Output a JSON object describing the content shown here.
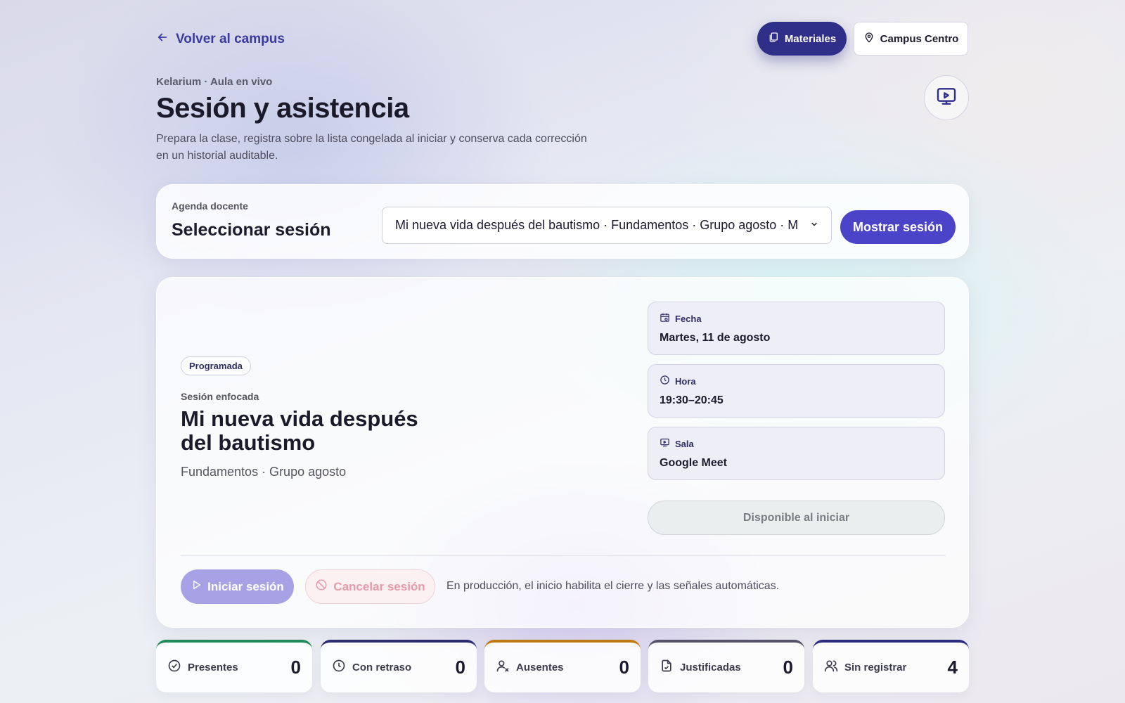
{
  "header": {
    "back_label": "Volver al campus",
    "materiales_label": "Materiales",
    "campus_label": "Campus Centro",
    "eyebrow": "Kelarium · Aula en vivo",
    "title": "Sesión y asistencia",
    "description": "Prepara la clase, registra sobre la lista congelada al iniciar y conserva cada corrección en un historial auditable."
  },
  "agenda": {
    "label": "Agenda docente",
    "title": "Seleccionar sesión",
    "selected_session": "Mi nueva vida después del bautismo · Fundamentos · Grupo agosto · M",
    "show_button": "Mostrar sesión"
  },
  "session": {
    "status": "Programada",
    "focus_label": "Sesión enfocada",
    "title": "Mi nueva vida después del bautismo",
    "subtitle": "Fundamentos · Grupo agosto",
    "fecha_label": "Fecha",
    "fecha_value": "Martes, 11 de agosto",
    "hora_label": "Hora",
    "hora_value": "19:30–20:45",
    "sala_label": "Sala",
    "sala_value": "Google Meet",
    "available_button": "Disponible al iniciar",
    "start_button": "Iniciar sesión",
    "cancel_button": "Cancelar sesión",
    "production_note": "En producción, el inicio habilita el cierre y las señales automáticas."
  },
  "stats": [
    {
      "label": "Presentes",
      "value": "0",
      "color": "#1f8a5c",
      "icon": "check-circle-icon"
    },
    {
      "label": "Con retraso",
      "value": "0",
      "color": "#2d2c6e",
      "icon": "clock-icon"
    },
    {
      "label": "Ausentes",
      "value": "0",
      "color": "#c47a14",
      "icon": "user-x-icon"
    },
    {
      "label": "Justificadas",
      "value": "0",
      "color": "#55536a",
      "icon": "file-check-icon"
    },
    {
      "label": "Sin registrar",
      "value": "4",
      "color": "#2d2c80",
      "icon": "users-icon"
    }
  ]
}
